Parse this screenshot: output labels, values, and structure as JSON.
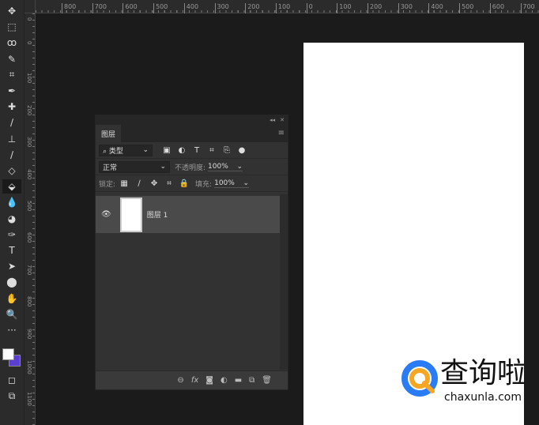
{
  "rulers": {
    "horizontal": [
      "800",
      "700",
      "600",
      "500",
      "400",
      "300",
      "200",
      "100",
      "0",
      "100",
      "200",
      "300",
      "400",
      "500",
      "600",
      "700"
    ],
    "vertical": [
      "0",
      "0",
      "100",
      "200",
      "300",
      "400",
      "500",
      "600",
      "700",
      "800",
      "900",
      "1000",
      "1100"
    ]
  },
  "toolbar": {
    "tools": [
      "move-icon",
      "marquee-icon",
      "lasso-icon",
      "quick-select-icon",
      "crop-icon",
      "eyedropper-icon",
      "healing-icon",
      "brush-icon",
      "stamp-icon",
      "history-brush-icon",
      "eraser-icon",
      "paint-bucket-icon",
      "blur-icon",
      "dodge-icon",
      "pen-icon",
      "type-icon",
      "path-select-icon",
      "ellipse-icon",
      "hand-icon",
      "zoom-icon",
      "more-icon"
    ],
    "glyphs": [
      "✥",
      "⬚",
      "ꝏ",
      "✎",
      "⌗",
      "✒",
      "✚",
      "∕",
      "⊥",
      "∕",
      "◇",
      "⬙",
      "💧",
      "◕",
      "✑",
      "T",
      "➤",
      "⬤",
      "✋",
      "🔍",
      "···"
    ],
    "active_index": 11,
    "foreground": "#ffffff",
    "background": "#5b3fd1"
  },
  "panel": {
    "tab": "图层",
    "collapse": "◂◂",
    "close": "✕",
    "menu": "≡",
    "filter": {
      "label": "类型",
      "icon": "⌕"
    },
    "blend_mode": "正常",
    "opacity_label": "不透明度:",
    "opacity": "100%",
    "lock_label": "锁定:",
    "fill_label": "填充:",
    "fill": "100%",
    "layers": [
      {
        "name": "图层 1",
        "visible": true
      }
    ],
    "bottom_icons": [
      "⊖",
      "fx",
      "◙",
      "◐",
      "▬",
      "⧉",
      "🗑"
    ]
  },
  "watermark": {
    "text": "查询啦",
    "domain": "chaxunla.com"
  }
}
